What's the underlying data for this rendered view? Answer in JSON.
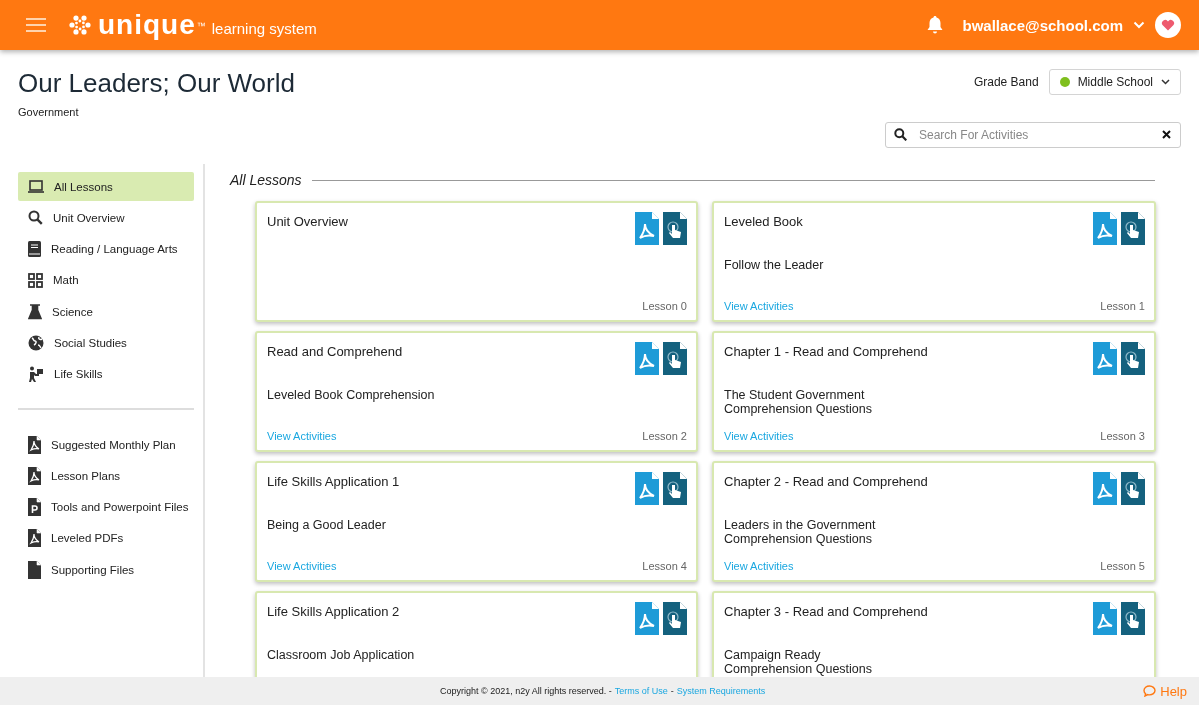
{
  "header": {
    "logo_word": "unique",
    "logo_tm": "™",
    "logo_tagline": "learning system",
    "user": "bwallace@school.com"
  },
  "page": {
    "title": "Our Leaders; Our World",
    "subtitle": "Government"
  },
  "grade_band": {
    "label": "Grade Band",
    "value": "Middle School",
    "color": "#7fbf1e"
  },
  "search": {
    "placeholder": "Search For Activities"
  },
  "sidebar": {
    "groups": [
      [
        {
          "label": "All Lessons",
          "selected": true
        },
        {
          "label": "Unit Overview",
          "selected": false
        },
        {
          "label": "Reading / Language Arts",
          "selected": false
        },
        {
          "label": "Math",
          "selected": false
        },
        {
          "label": "Science",
          "selected": false
        },
        {
          "label": "Social Studies",
          "selected": false
        },
        {
          "label": "Life Skills",
          "selected": false
        }
      ],
      [
        {
          "label": "Suggested Monthly Plan",
          "selected": false
        },
        {
          "label": "Lesson Plans",
          "selected": false
        },
        {
          "label": "Tools and Powerpoint Files",
          "selected": false
        },
        {
          "label": "Leveled PDFs",
          "selected": false
        },
        {
          "label": "Supporting Files",
          "selected": false
        }
      ]
    ]
  },
  "section_title": "All Lessons",
  "cards": [
    {
      "title": "Unit Overview",
      "lesson": "Lesson 0"
    },
    {
      "title": "Leveled Book",
      "subtitle": [
        "Follow the Leader"
      ],
      "link": "View Activities",
      "lesson": "Lesson 1"
    },
    {
      "title": "Read and Comprehend",
      "subtitle": [
        "Leveled Book Comprehension"
      ],
      "link": "View Activities",
      "lesson": "Lesson 2"
    },
    {
      "title": "Chapter 1 - Read and Comprehend",
      "subtitle": [
        "The Student Government",
        "Comprehension Questions"
      ],
      "link": "View Activities",
      "lesson": "Lesson 3"
    },
    {
      "title": "Life Skills Application 1",
      "subtitle": [
        "Being a Good Leader"
      ],
      "link": "View Activities",
      "lesson": "Lesson 4"
    },
    {
      "title": "Chapter 2 - Read and Comprehend",
      "subtitle": [
        "Leaders in the Government",
        "Comprehension Questions"
      ],
      "link": "View Activities",
      "lesson": "Lesson 5"
    },
    {
      "title": "Life Skills Application 2",
      "subtitle": [
        "Classroom Job Application"
      ]
    },
    {
      "title": "Chapter 3 - Read and Comprehend",
      "subtitle": [
        "Campaign Ready",
        "Comprehension Questions"
      ]
    }
  ],
  "footer": {
    "copyright": "Copyright © 2021, n2y All rights reserved. -",
    "terms": "Terms of Use",
    "separator": "-",
    "requirements": "System Requirements",
    "help": "Help"
  }
}
